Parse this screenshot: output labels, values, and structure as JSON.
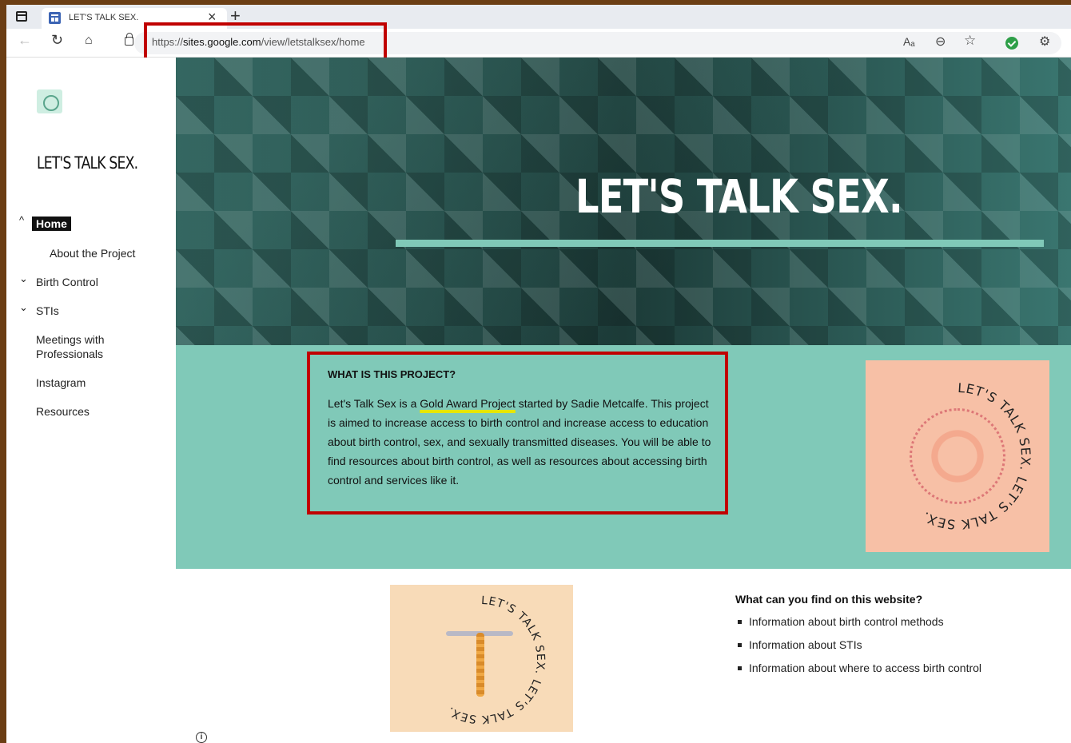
{
  "browser": {
    "tab_title": "LET'S TALK SEX.",
    "tab_close": "×",
    "new_tab": "+",
    "url_prefix": "https://",
    "url_domain": "sites.google.com",
    "url_path": "/view/letstalksex/home",
    "read_aloud": "Aₐ",
    "zoom": "⊖",
    "favorite": "☆",
    "extensions": "⚙"
  },
  "sidebar": {
    "site_title": "LET'S TALK SEX.",
    "items": [
      {
        "label": "Home",
        "active": true
      },
      {
        "label": "About the Project"
      },
      {
        "label": "Birth Control"
      },
      {
        "label": "STIs"
      },
      {
        "label": "Meetings with Professionals"
      },
      {
        "label": "Instagram"
      },
      {
        "label": "Resources"
      }
    ]
  },
  "hero": {
    "title": "LET'S TALK SEX."
  },
  "project": {
    "heading": "WHAT IS THIS PROJECT?",
    "text_before": "Let's Talk Sex is a ",
    "link": "Gold Award Project",
    "text_after": " started by Sadie Metcalfe. This project is aimed to increase access to birth control and increase access to education about birth control, sex, and sexually transmitted diseases. You will be able to find resources about birth control, as well as resources about accessing birth control and services like it."
  },
  "images": {
    "ring_text": "LET'S TALK SEX. LET'S TALK SEX."
  },
  "find": {
    "heading": "What can you find on this website?",
    "items": [
      "Information about birth control methods",
      "Information about STIs",
      "Information about where to access birth control"
    ]
  },
  "colors": {
    "accent": "#80c9b8",
    "hero_bg": "#234845",
    "highlight": "#c00000",
    "underline": "#e6e600"
  }
}
